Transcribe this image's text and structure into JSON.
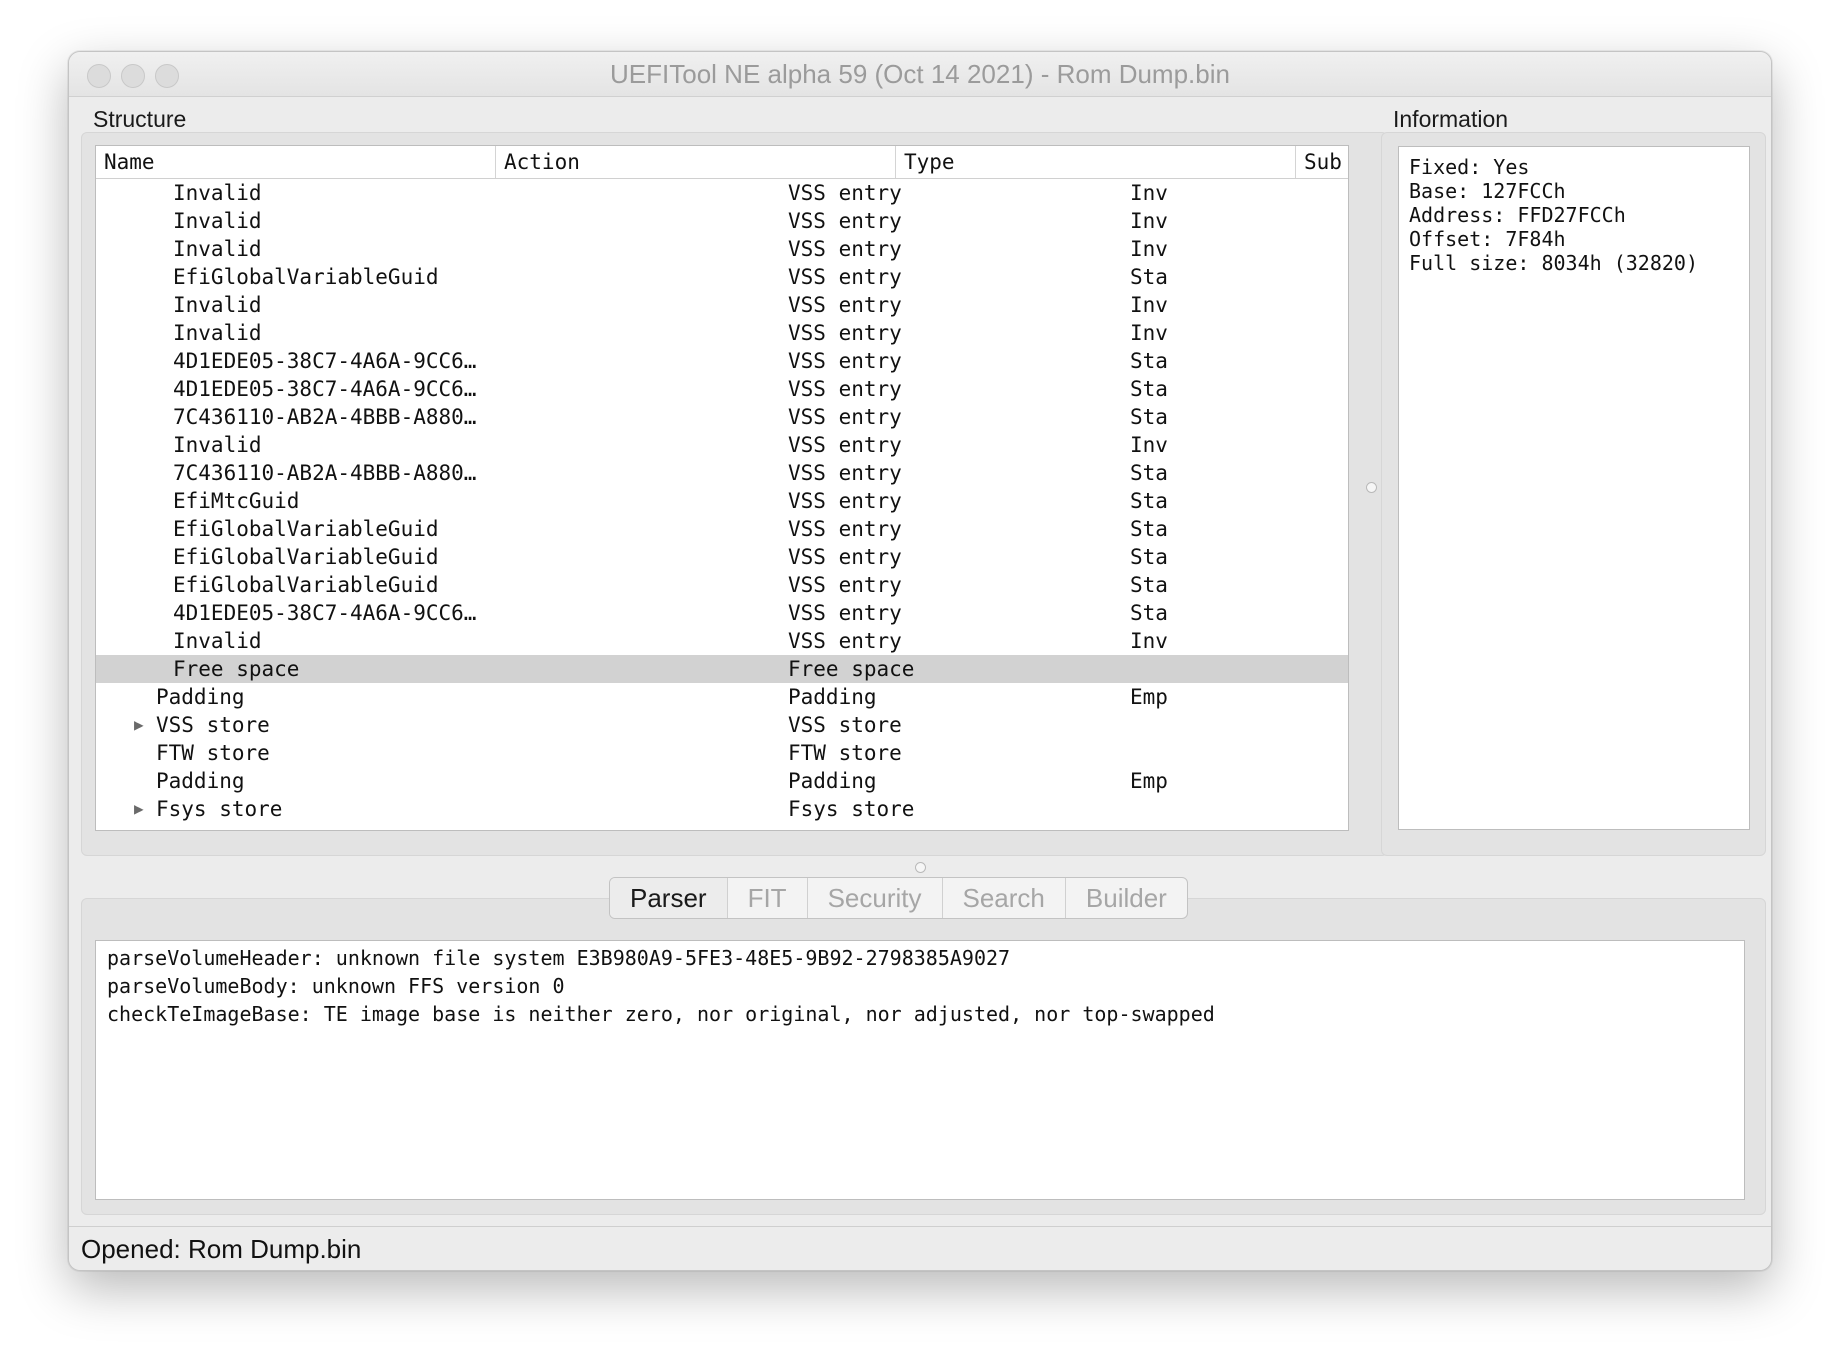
{
  "window": {
    "title": "UEFITool NE alpha 59 (Oct 14 2021) - Rom Dump.bin"
  },
  "structure": {
    "label": "Structure",
    "columns": [
      "Name",
      "Action",
      "Type",
      "Sub"
    ],
    "rows": [
      {
        "name": "Invalid",
        "action": "",
        "type": "VSS entry",
        "subtype": "Inv",
        "depth": 2,
        "expandable": false,
        "selected": false
      },
      {
        "name": "Invalid",
        "action": "",
        "type": "VSS entry",
        "subtype": "Inv",
        "depth": 2,
        "expandable": false,
        "selected": false
      },
      {
        "name": "Invalid",
        "action": "",
        "type": "VSS entry",
        "subtype": "Inv",
        "depth": 2,
        "expandable": false,
        "selected": false
      },
      {
        "name": "EfiGlobalVariableGuid",
        "action": "",
        "type": "VSS entry",
        "subtype": "Sta",
        "depth": 2,
        "expandable": false,
        "selected": false
      },
      {
        "name": "Invalid",
        "action": "",
        "type": "VSS entry",
        "subtype": "Inv",
        "depth": 2,
        "expandable": false,
        "selected": false
      },
      {
        "name": "Invalid",
        "action": "",
        "type": "VSS entry",
        "subtype": "Inv",
        "depth": 2,
        "expandable": false,
        "selected": false
      },
      {
        "name": "4D1EDE05-38C7-4A6A-9CC6…",
        "action": "",
        "type": "VSS entry",
        "subtype": "Sta",
        "depth": 2,
        "expandable": false,
        "selected": false
      },
      {
        "name": "4D1EDE05-38C7-4A6A-9CC6…",
        "action": "",
        "type": "VSS entry",
        "subtype": "Sta",
        "depth": 2,
        "expandable": false,
        "selected": false
      },
      {
        "name": "7C436110-AB2A-4BBB-A880…",
        "action": "",
        "type": "VSS entry",
        "subtype": "Sta",
        "depth": 2,
        "expandable": false,
        "selected": false
      },
      {
        "name": "Invalid",
        "action": "",
        "type": "VSS entry",
        "subtype": "Inv",
        "depth": 2,
        "expandable": false,
        "selected": false
      },
      {
        "name": "7C436110-AB2A-4BBB-A880…",
        "action": "",
        "type": "VSS entry",
        "subtype": "Sta",
        "depth": 2,
        "expandable": false,
        "selected": false
      },
      {
        "name": "EfiMtcGuid",
        "action": "",
        "type": "VSS entry",
        "subtype": "Sta",
        "depth": 2,
        "expandable": false,
        "selected": false
      },
      {
        "name": "EfiGlobalVariableGuid",
        "action": "",
        "type": "VSS entry",
        "subtype": "Sta",
        "depth": 2,
        "expandable": false,
        "selected": false
      },
      {
        "name": "EfiGlobalVariableGuid",
        "action": "",
        "type": "VSS entry",
        "subtype": "Sta",
        "depth": 2,
        "expandable": false,
        "selected": false
      },
      {
        "name": "EfiGlobalVariableGuid",
        "action": "",
        "type": "VSS entry",
        "subtype": "Sta",
        "depth": 2,
        "expandable": false,
        "selected": false
      },
      {
        "name": "4D1EDE05-38C7-4A6A-9CC6…",
        "action": "",
        "type": "VSS entry",
        "subtype": "Sta",
        "depth": 2,
        "expandable": false,
        "selected": false
      },
      {
        "name": "Invalid",
        "action": "",
        "type": "VSS entry",
        "subtype": "Inv",
        "depth": 2,
        "expandable": false,
        "selected": false
      },
      {
        "name": "Free space",
        "action": "",
        "type": "Free space",
        "subtype": "",
        "depth": 2,
        "expandable": false,
        "selected": true
      },
      {
        "name": "Padding",
        "action": "",
        "type": "Padding",
        "subtype": "Emp",
        "depth": 1,
        "expandable": false,
        "selected": false
      },
      {
        "name": "VSS store",
        "action": "",
        "type": "VSS store",
        "subtype": "",
        "depth": 1,
        "expandable": true,
        "selected": false
      },
      {
        "name": "FTW store",
        "action": "",
        "type": "FTW store",
        "subtype": "",
        "depth": 1,
        "expandable": false,
        "selected": false
      },
      {
        "name": "Padding",
        "action": "",
        "type": "Padding",
        "subtype": "Emp",
        "depth": 1,
        "expandable": false,
        "selected": false
      },
      {
        "name": "Fsys store",
        "action": "",
        "type": "Fsys store",
        "subtype": "",
        "depth": 1,
        "expandable": true,
        "selected": false
      }
    ]
  },
  "information": {
    "label": "Information",
    "lines": [
      "Fixed: Yes",
      "Base: 127FCCh",
      "Address: FFD27FCCh",
      "Offset: 7F84h",
      "Full size: 8034h (32820)"
    ]
  },
  "tabs": {
    "items": [
      "Parser",
      "FIT",
      "Security",
      "Search",
      "Builder"
    ],
    "active": "Parser"
  },
  "messages": {
    "lines": [
      "parseVolumeHeader: unknown file system E3B980A9-5FE3-48E5-9B92-2798385A9027",
      "parseVolumeBody: unknown FFS version 0",
      "checkTeImageBase: TE image base is neither zero, nor original, nor adjusted, nor top-swapped"
    ]
  },
  "status": {
    "text": "Opened: Rom Dump.bin"
  },
  "icons": {
    "expander": "disclosure-triangle-icon"
  },
  "colors": {
    "selection": "#d2d2d2",
    "window_bg": "#ececec"
  }
}
